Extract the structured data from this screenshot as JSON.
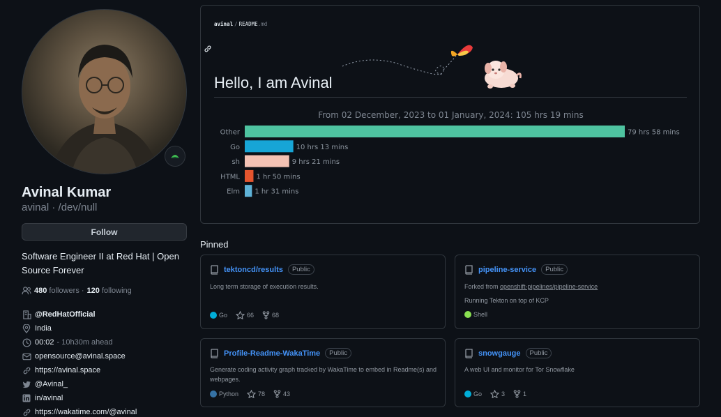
{
  "profile": {
    "avatar_alt": "Avinal Kumar avatar",
    "status_icon": "status-emoji-icon",
    "name": "Avinal Kumar",
    "login": "avinal · /dev/null",
    "follow_label": "Follow",
    "bio": "Software Engineer II at Red Hat | Open Source Forever",
    "followers_count": "480",
    "followers_label": "followers ·",
    "following_count": "120",
    "following_label": "following",
    "details": {
      "org": "@RedHatOfficial",
      "location": "India",
      "time": "00:02",
      "time_note": "- 10h30m ahead",
      "email": "opensource@avinal.space",
      "website": "https://avinal.space",
      "twitter": "@Avinal_",
      "linkedin": "in/avinal",
      "wakatime": "https://wakatime.com/@avinal"
    }
  },
  "readme": {
    "path_owner": "avinal",
    "path_sep": "/",
    "path_file": "README",
    "path_ext": ".md",
    "heading": "Hello, I am Avinal"
  },
  "chart_data": {
    "type": "bar",
    "orientation": "horizontal",
    "title": "From 02 December, 2023 to 01 January, 2024: 105 hrs 19 mins",
    "categories": [
      "Other",
      "Go",
      "sh",
      "HTML",
      "Elm"
    ],
    "values": [
      79.97,
      10.22,
      9.35,
      1.83,
      1.52
    ],
    "value_labels": [
      "79 hrs 58 mins",
      "10 hrs 13 mins",
      "9 hrs 21 mins",
      "1 hr 50 mins",
      "1 hr 31 mins"
    ],
    "colors": [
      "#4ec3a0",
      "#17a5d6",
      "#f4c2b4",
      "#e4552e",
      "#5fb3d8"
    ],
    "xlim": [
      0,
      79.97
    ],
    "grid": false,
    "legend": "none"
  },
  "pinned": {
    "title": "Pinned",
    "cards": [
      {
        "name": "tektoncd/results",
        "badge": "Public",
        "desc": "Long term storage of execution results.",
        "fork_prefix": "",
        "fork_link": "",
        "desc2": "",
        "lang": "Go",
        "lang_color": "#00ADD8",
        "stars": "66",
        "forks": "68"
      },
      {
        "name": "pipeline-service",
        "badge": "Public",
        "desc": "",
        "fork_prefix": "Forked from",
        "fork_link": "openshift-pipelines/pipeline-service",
        "desc2": "Running Tekton on top of KCP",
        "lang": "Shell",
        "lang_color": "#89e051",
        "stars": "",
        "forks": ""
      },
      {
        "name": "Profile-Readme-WakaTime",
        "badge": "Public",
        "desc": "Generate coding activity graph tracked by WakaTime to embed in Readme(s) and webpages.",
        "lang": "Python",
        "lang_color": "#3572A5",
        "stars": "78",
        "forks": "43"
      },
      {
        "name": "snowgauge",
        "badge": "Public",
        "desc": "A web UI and monitor for Tor Snowflake",
        "lang": "Go",
        "lang_color": "#00ADD8",
        "stars": "3",
        "forks": "1"
      }
    ]
  }
}
